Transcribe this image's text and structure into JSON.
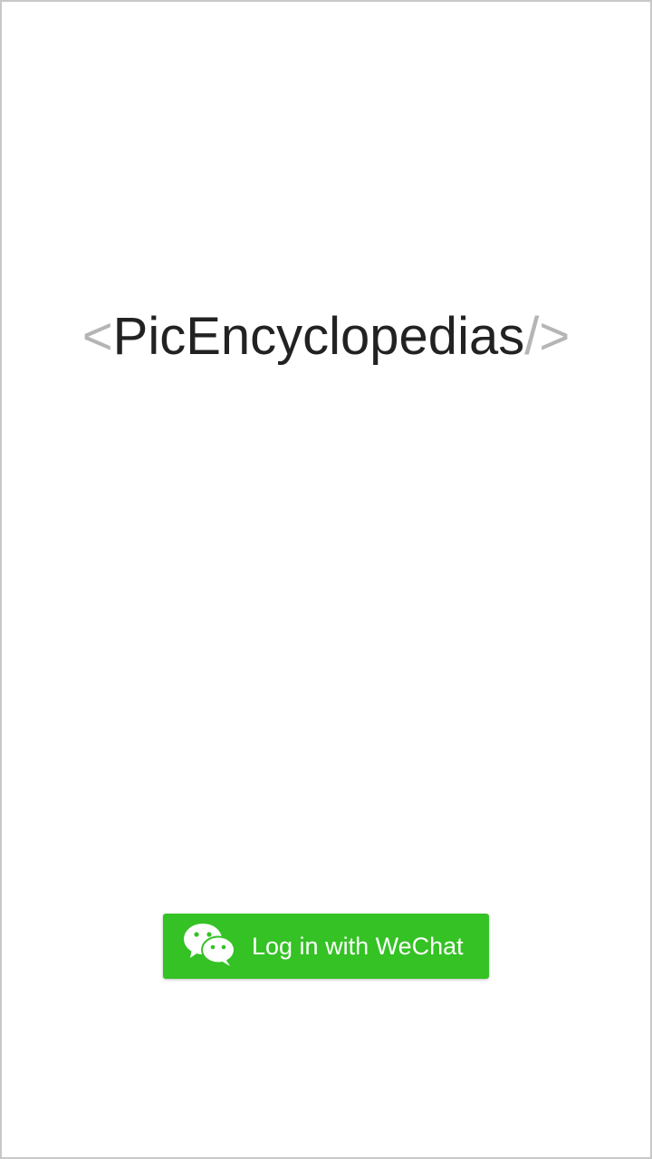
{
  "logo": {
    "open_bracket": "<",
    "app_name": "PicEncyclopedias",
    "close_bracket": "/>"
  },
  "login": {
    "button_label": "Log in with WeChat",
    "icon": "wechat-icon",
    "button_color": "#34c224"
  },
  "colors": {
    "bracket": "#b5b5b5",
    "app_name": "#222222",
    "background": "#ffffff"
  }
}
